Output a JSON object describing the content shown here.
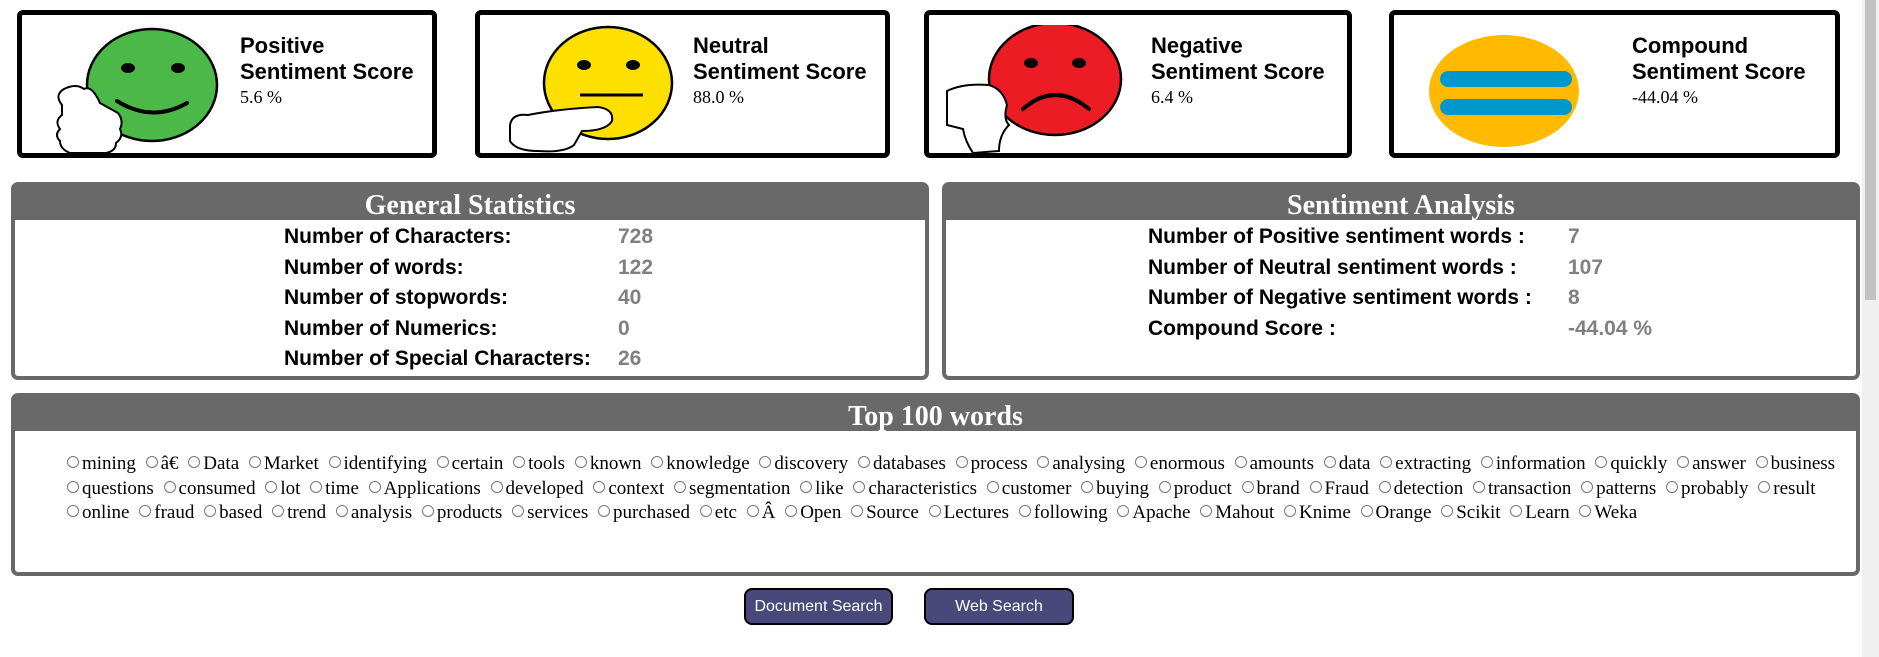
{
  "score_cards": [
    {
      "title_line1": "Positive",
      "title_line2": "Sentiment Score",
      "score": "5.6 %",
      "icon": "thumbs-up-smiley",
      "color": "#4cb848"
    },
    {
      "title_line1": "Neutral",
      "title_line2": "Sentiment Score",
      "score": "88.0 %",
      "icon": "neutral-face-pointing",
      "color": "#fde000"
    },
    {
      "title_line1": "Negative",
      "title_line2": "Sentiment Score",
      "score": "6.4 %",
      "icon": "thumbs-down-frown",
      "color": "#ec1c24"
    },
    {
      "title_line1": "Compound",
      "title_line2": "Sentiment Score",
      "score": "-44.04 %",
      "icon": "equals-sign",
      "color": "#ffba00"
    }
  ],
  "general_statistics": {
    "title": "General Statistics",
    "rows": [
      {
        "label": "Number of Characters:",
        "value": "728"
      },
      {
        "label": "Number of words:",
        "value": "122"
      },
      {
        "label": "Number of stopwords:",
        "value": "40"
      },
      {
        "label": "Number of Numerics:",
        "value": "0"
      },
      {
        "label": "Number of Special Characters:",
        "value": "26"
      }
    ]
  },
  "sentiment_analysis": {
    "title": "Sentiment Analysis",
    "rows": [
      {
        "label": "Number of Positive sentiment words :",
        "value": "7"
      },
      {
        "label": "Number of Neutral sentiment words :",
        "value": "107"
      },
      {
        "label": "Number of Negative sentiment words :",
        "value": "8"
      },
      {
        "label": "Compound Score :",
        "value": "-44.04 %"
      }
    ]
  },
  "top_words": {
    "title": "Top 100 words",
    "words": [
      "mining",
      "â€",
      "Data",
      "Market",
      "identifying",
      "certain",
      "tools",
      "known",
      "knowledge",
      "discovery",
      "databases",
      "process",
      "analysing",
      "enormous",
      "amounts",
      "data",
      "extracting",
      "information",
      "quickly",
      "answer",
      "business",
      "questions",
      "consumed",
      "lot",
      "time",
      "Applications",
      "developed",
      "context",
      "segmentation",
      "like",
      "characteristics",
      "customer",
      "buying",
      "product",
      "brand",
      "Fraud",
      "detection",
      "transaction",
      "patterns",
      "probably",
      "result",
      "online",
      "fraud",
      "based",
      "trend",
      "analysis",
      "products",
      "services",
      "purchased",
      "etc",
      "Â",
      "Open",
      "Source",
      "Lectures",
      "following",
      "Apache",
      "Mahout",
      "Knime",
      "Orange",
      "Scikit",
      "Learn",
      "Weka"
    ]
  },
  "buttons": {
    "document_search": "Document Search",
    "web_search": "Web Search"
  }
}
